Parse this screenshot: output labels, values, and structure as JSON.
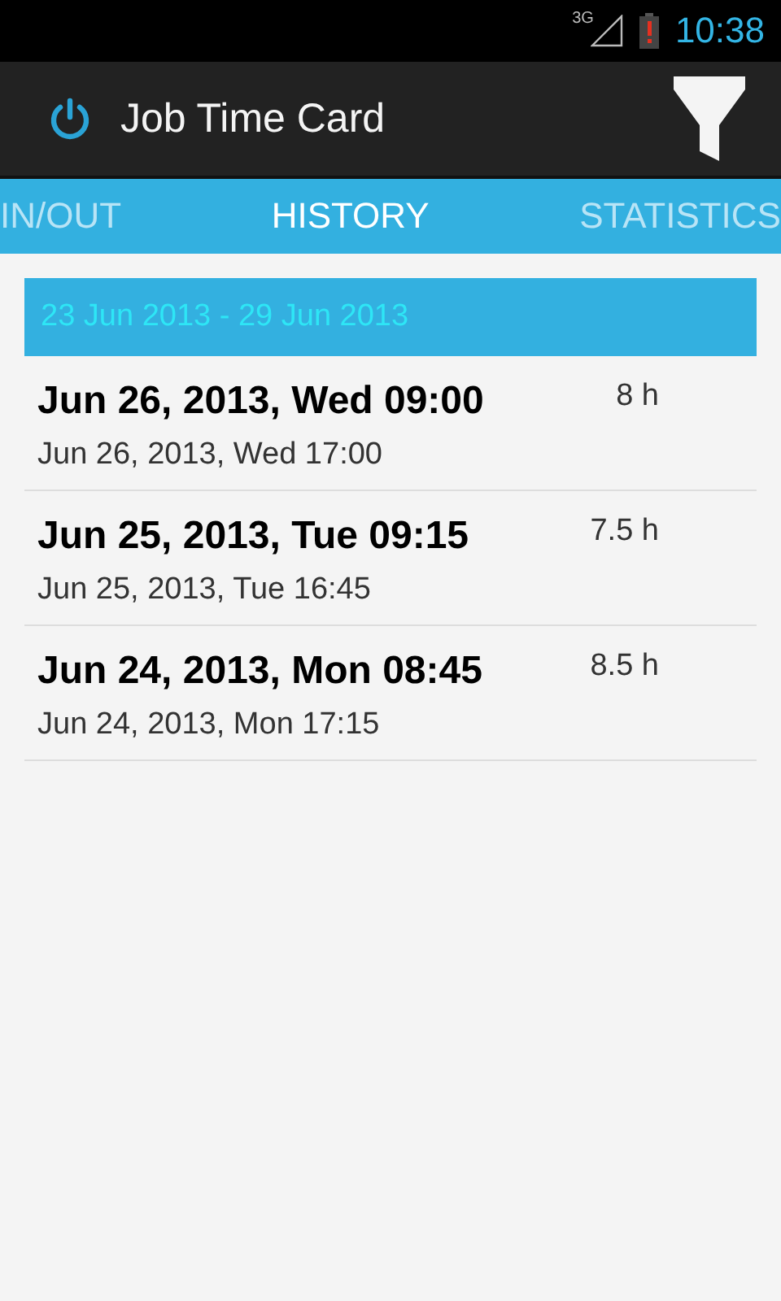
{
  "status_bar": {
    "network": "3G",
    "battery_alert": true,
    "time": "10:38"
  },
  "action_bar": {
    "title": "Job Time Card"
  },
  "tabs": [
    {
      "label": "IN/OUT",
      "selected": false
    },
    {
      "label": "HISTORY",
      "selected": true
    },
    {
      "label": "STATISTICS",
      "selected": false
    }
  ],
  "week_header": "23 Jun 2013 - 29 Jun 2013",
  "entries": [
    {
      "start": "Jun 26, 2013, Wed 09:00",
      "end": "Jun 26, 2013, Wed 17:00",
      "hours": "8 h"
    },
    {
      "start": "Jun 25, 2013, Tue 09:15",
      "end": "Jun 25, 2013, Tue 16:45",
      "hours": "7.5 h"
    },
    {
      "start": "Jun 24, 2013, Mon 08:45",
      "end": "Jun 24, 2013, Mon 17:15",
      "hours": "8.5 h"
    }
  ]
}
